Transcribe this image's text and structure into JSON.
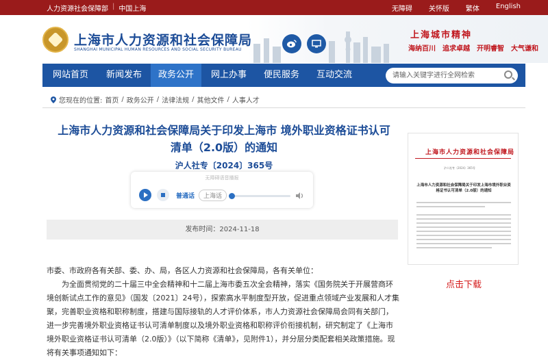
{
  "topbar": {
    "links_left": [
      "人力资源社会保障部",
      "中国上海"
    ],
    "links_right": [
      "无障碍",
      "关怀版",
      "繁体",
      "English"
    ]
  },
  "header": {
    "org_cn": "上海市人力资源和社会保障局",
    "org_en": "SHANGHAI MUNICIPAL HUMAN RESOURCES AND SOCIAL SECURITY BUREAU",
    "spirit_title": "上海城市精神",
    "spirit": [
      "海纳百川",
      "追求卓越",
      "开明睿智",
      "大气谦和"
    ]
  },
  "nav": {
    "items": [
      "网站首页",
      "新闻发布",
      "政务公开",
      "网上办事",
      "便民服务",
      "互动交流"
    ],
    "active_index": 2,
    "search_placeholder": "请输入关键字进行全网检索"
  },
  "breadcrumb": {
    "label": "您现在的位置:",
    "items": [
      "首页",
      "政务公开",
      "法律法规",
      "其他文件",
      "人事人才"
    ]
  },
  "article": {
    "title_line1": "上海市人力资源和社会保障局关于印发上海市 境外职业资格证书认可",
    "title_line2": "清单（2.0版）的通知",
    "doc_no": "沪人社专〔2024〕365号",
    "player": {
      "hint": "无障碍语音播报",
      "lang_active": "普通话",
      "lang_other": "上海话"
    },
    "date": "发布时间：2024-11-18",
    "salutation": "市委、市政府各有关部、委、办、局，各区人力资源和社会保障局，各有关单位：",
    "paragraph": "为全面贯彻党的二十届三中全会精神和十二届上海市委五次全会精神，落实《国务院关于开展营商环境创新试点工作的意见》（国发〔2021〕24号），探索高水平制度型开放，促进重点领域产业发展和人才集聚，完善职业资格和职称制度，搭建与国际接轨的人才评价体系，市人力资源社会保障局会同有关部门，进一步完善境外职业资格证书认可清单制度以及境外职业资格和职称评价衔接机制，研究制定了《上海市境外职业资格证书认可清单（2.0版）》（以下简称《清单》，见附件1），并分层分类配套相关政策措施。现将有关事项通知如下："
  },
  "sidebar": {
    "thumb_head": "上海市人力资源和社会保障局",
    "thumb_no": "沪人社专〔2024〕365号",
    "thumb_title": "上海市人力资源和社会保障局关于印发上海市境外职业资格证书认可清单（2.0版）的通知",
    "download": "点击下载"
  },
  "colors": {
    "brand_red": "#9a1b1b",
    "nav_blue": "#1d55a3",
    "title_blue": "#1c4c97",
    "accent_red": "#d41a1a"
  }
}
